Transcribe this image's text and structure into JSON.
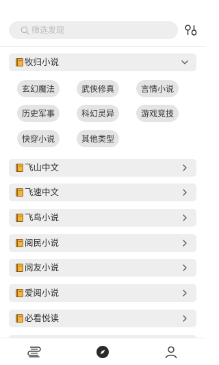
{
  "search": {
    "placeholder": "筛选发现"
  },
  "sections": [
    {
      "label": "牧归小说",
      "expanded": true,
      "tags": [
        "玄幻魔法",
        "武侠修真",
        "言情小说",
        "历史军事",
        "科幻灵异",
        "游戏竞技",
        "快穿小说",
        "其他类型"
      ]
    },
    {
      "label": "飞山中文",
      "expanded": false
    },
    {
      "label": "飞速中文",
      "expanded": false
    },
    {
      "label": "飞鸟小说",
      "expanded": false
    },
    {
      "label": "阅民小说",
      "expanded": false
    },
    {
      "label": "阅友小说",
      "expanded": false
    },
    {
      "label": "爱阅小说",
      "expanded": false
    },
    {
      "label": "必看悦读",
      "expanded": false
    }
  ],
  "icons": {
    "search": "search-icon",
    "filter": "filter-icon",
    "book": "book-icon",
    "expand": "chevron-down-icon",
    "collapse": "chevron-right-icon",
    "nav_bookshelf": "bookshelf-icon",
    "nav_discover": "compass-icon",
    "nav_profile": "user-icon"
  },
  "bottom_nav": {
    "active": "discover"
  },
  "colors": {
    "row_bg": "#eeeeee",
    "chip_bg": "#e4e4e4",
    "book_yellow": "#f1b63c",
    "book_brown": "#8a5a1e"
  }
}
